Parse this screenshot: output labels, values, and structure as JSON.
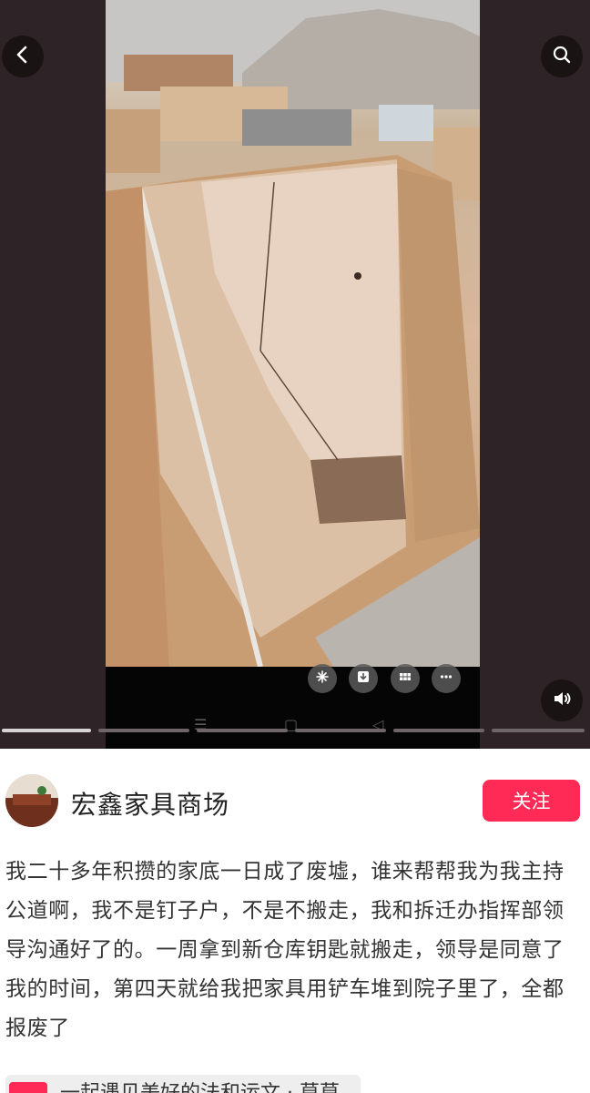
{
  "viewer": {
    "back_icon": "chevron-left-icon",
    "search_icon": "search-icon",
    "sound_icon": "speaker-icon",
    "video_tools": [
      "sparkle-icon",
      "download-icon",
      "grid-icon",
      "more-icon"
    ],
    "nav_keys": {
      "menu": "☰",
      "home": "▢",
      "back": "◁"
    },
    "progress": {
      "segments": 6,
      "active_index": 0
    }
  },
  "post": {
    "author": "宏鑫家具商场",
    "follow_label": "关注",
    "caption": "我二十多年积攒的家底一日成了废墟，谁来帮帮我为我主持公道啊，我不是钉子户，不是不搬走，我和拆迁办指挥部领导沟通好了的。一周拿到新仓库钥匙就搬走，领导是同意了我的时间，第四天就给我把家具用铲车堆到院子里了，全都报废了",
    "related": "一起遇见美好的法和运文 · 莫莫"
  },
  "colors": {
    "accent": "#ff2a55",
    "viewer_bg": "#2e2326"
  }
}
